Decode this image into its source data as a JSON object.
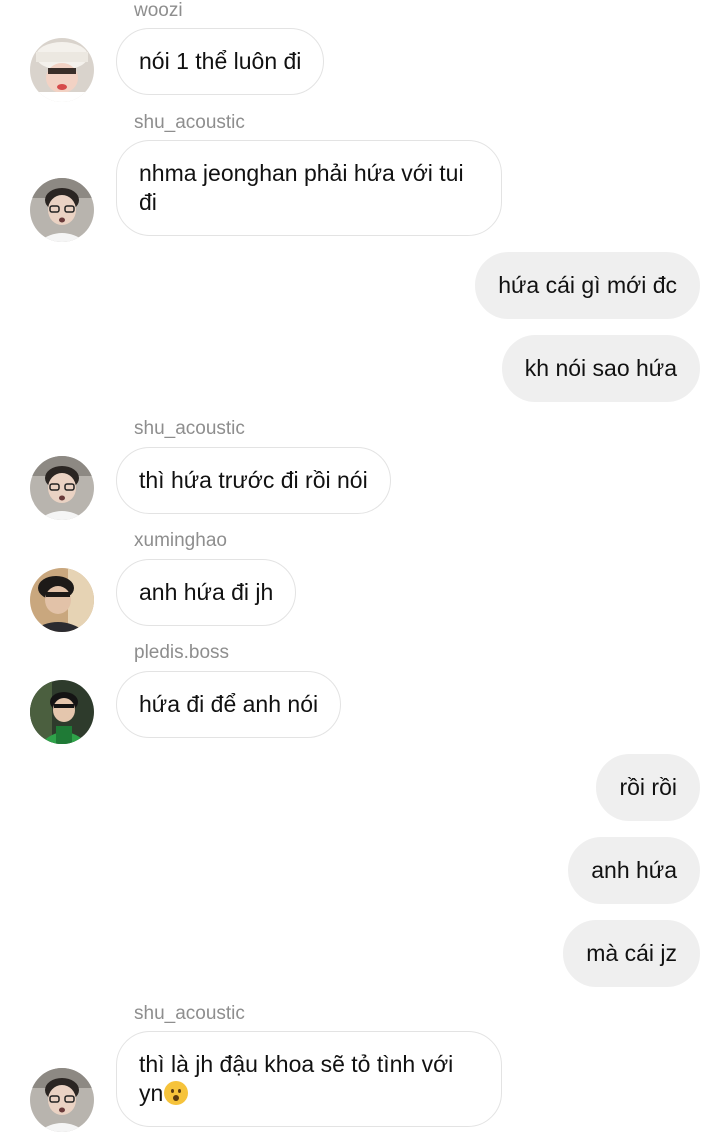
{
  "messages": [
    {
      "sender": "woozi",
      "text": "nói 1 thể luôn đi",
      "avatar": "woozi-avatar"
    },
    {
      "sender": "shu_acoustic",
      "text": "nhma jeonghan phải hứa với tui đi",
      "avatar": "shu-acoustic-avatar"
    },
    {
      "sender": "me",
      "text": "hứa cái gì mới đc"
    },
    {
      "sender": "me",
      "text": "kh nói sao hứa"
    },
    {
      "sender": "shu_acoustic",
      "text": "thì hứa trước đi rồi nói",
      "avatar": "shu-acoustic-avatar"
    },
    {
      "sender": "xuminghao",
      "text": "anh hứa đi jh",
      "avatar": "xuminghao-avatar"
    },
    {
      "sender": "pledis.boss",
      "text": "hứa đi để anh nói",
      "avatar": "pledis-boss-avatar"
    },
    {
      "sender": "me",
      "text": "rồi rồi"
    },
    {
      "sender": "me",
      "text": "anh hứa"
    },
    {
      "sender": "me",
      "text": "mà cái jz"
    },
    {
      "sender": "shu_acoustic",
      "text": "thì là jh đậu khoa sẽ tỏ tình với yn",
      "emoji": "hushed-face-emoji",
      "avatar": "shu-acoustic-avatar"
    }
  ],
  "colors": {
    "outgoing_bubble": "#efefef",
    "incoming_border": "#e3e3e3",
    "username": "#8e8e8e"
  }
}
